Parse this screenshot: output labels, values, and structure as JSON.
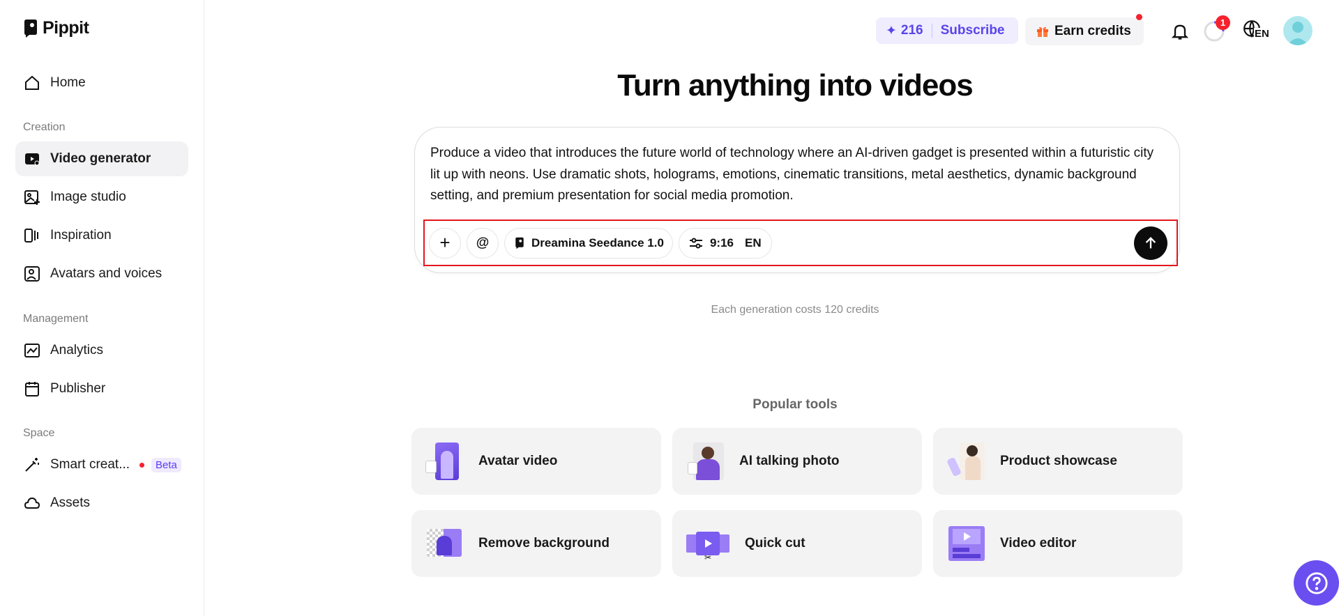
{
  "brand": {
    "name": "Pippit"
  },
  "sidebar": {
    "home": "Home",
    "sections": {
      "creation": "Creation",
      "management": "Management",
      "space": "Space"
    },
    "creation_items": [
      {
        "label": "Video generator",
        "icon": "video-generator-icon",
        "active": true
      },
      {
        "label": "Image studio",
        "icon": "image-studio-icon"
      },
      {
        "label": "Inspiration",
        "icon": "inspiration-icon"
      },
      {
        "label": "Avatars and voices",
        "icon": "avatar-voice-icon"
      }
    ],
    "management_items": [
      {
        "label": "Analytics",
        "icon": "analytics-icon"
      },
      {
        "label": "Publisher",
        "icon": "calendar-icon"
      }
    ],
    "space_items": [
      {
        "label": "Smart creat...",
        "icon": "magic-wand-icon",
        "badge": "Beta"
      },
      {
        "label": "Assets",
        "icon": "cloud-icon"
      }
    ]
  },
  "header": {
    "credits": "216",
    "subscribe_label": "Subscribe",
    "earn_label": "Earn credits",
    "notification_count": "1",
    "language": "EN"
  },
  "main": {
    "title": "Turn anything into videos",
    "prompt": "Produce a video that introduces the future world of technology where an AI-driven gadget is presented within a futuristic city lit up with neons. Use dramatic shots, holograms, emotions, cinematic transitions, metal aesthetics, dynamic background setting, and premium presentation for social media promotion.",
    "toolbar": {
      "add_label": "+",
      "mention_label": "@",
      "model": "Dreamina Seedance 1.0",
      "ratio": "9:16",
      "language": "EN"
    },
    "cost_note": "Each generation costs 120 credits",
    "popular_title": "Popular tools",
    "tools": [
      {
        "label": "Avatar video"
      },
      {
        "label": "AI talking photo"
      },
      {
        "label": "Product showcase"
      },
      {
        "label": "Remove background"
      },
      {
        "label": "Quick cut"
      },
      {
        "label": "Video editor"
      }
    ]
  },
  "colors": {
    "accent": "#6b4ef0",
    "highlight": "#e3161d",
    "badge": "#f5222d"
  }
}
